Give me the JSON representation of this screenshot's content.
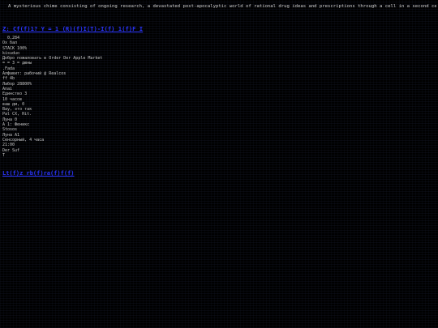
{
  "header": {
    "text": "A mysterious chime consisting of ongoing research, a devastated post-apocalyptic world of rational drug ideas and prescriptions through a cell in a second cell,"
  },
  "title_link": "Z: Cf(f)1? Y = 1 (R)(f)I(T)-I(f) 1(f)F I",
  "log_lines": [
    "0,284",
    "Ox бал",
    "STACK 100%",
    "kisuduo",
    "Добро пожаловать в Order Der Apple Market",
    "= = 3 = дюны",
    ".Fada",
    "Алфавит: рабочий @ Realcos",
    "ff 4b",
    "Лабор 28800%",
    "Anai",
    "Единство 3",
    "10 часов",
    "ваш дм, 0",
    "Вау, это так",
    "Pal CX, Hit.",
    "Луна 0",
    "А 1: Феникс",
    "Stosos",
    "Луна A1",
    "Сенсорный, 4 часа",
    "21:00",
    "Der Suf",
    "T"
  ],
  "footer_link": "Lt(f)z rb(f)ra(f)f(f)",
  "colors": {
    "background": "#000000",
    "text": "#c4c4c4",
    "link": "#2a35ff"
  }
}
